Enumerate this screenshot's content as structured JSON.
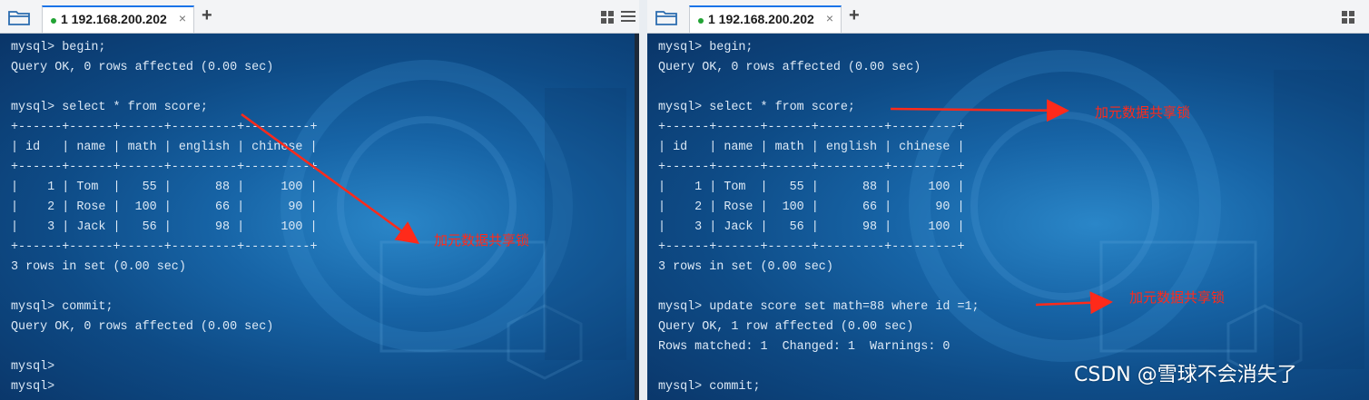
{
  "left_window": {
    "tab": {
      "title": "1 192.168.200.202",
      "close_label": "×"
    },
    "add_tab_label": "+",
    "terminal_lines": [
      "mysql> begin;",
      "Query OK, 0 rows affected (0.00 sec)",
      "",
      "mysql> select * from score;",
      "+------+------+------+---------+---------+",
      "| id   | name | math | english | chinese |",
      "+------+------+------+---------+---------+",
      "|    1 | Tom  |   55 |      88 |     100 |",
      "|    2 | Rose |  100 |      66 |      90 |",
      "|    3 | Jack |   56 |      98 |     100 |",
      "+------+------+------+---------+---------+",
      "3 rows in set (0.00 sec)",
      "",
      "mysql> commit;",
      "Query OK, 0 rows affected (0.00 sec)",
      "",
      "mysql>",
      "mysql>"
    ],
    "annotation": "加元数据共享锁"
  },
  "right_window": {
    "tab": {
      "title": "1 192.168.200.202",
      "close_label": "×"
    },
    "add_tab_label": "+",
    "terminal_lines": [
      "mysql> begin;",
      "Query OK, 0 rows affected (0.00 sec)",
      "",
      "mysql> select * from score;",
      "+------+------+------+---------+---------+",
      "| id   | name | math | english | chinese |",
      "+------+------+------+---------+---------+",
      "|    1 | Tom  |   55 |      88 |     100 |",
      "|    2 | Rose |  100 |      66 |      90 |",
      "|    3 | Jack |   56 |      98 |     100 |",
      "+------+------+------+---------+---------+",
      "3 rows in set (0.00 sec)",
      "",
      "mysql> update score set math=88 where id =1;",
      "Query OK, 1 row affected (0.00 sec)",
      "Rows matched: 1  Changed: 1  Warnings: 0",
      "",
      "mysql> commit;"
    ],
    "annotation_1": "加元数据共享锁",
    "annotation_2": "加元数据共享锁"
  },
  "watermark": "CSDN @雪球不会消失了",
  "colors": {
    "annotation": "#ff2a1a",
    "terminal_text": "#dce9f6",
    "terminal_bg": "#1764a6",
    "tab_accent": "#1a73e8",
    "status_dot": "#22a334"
  },
  "icons": [
    "folder-icon",
    "status-dot-icon",
    "close-icon",
    "plus-icon",
    "grid-view-icon",
    "menu-icon",
    "arrow-icon"
  ]
}
